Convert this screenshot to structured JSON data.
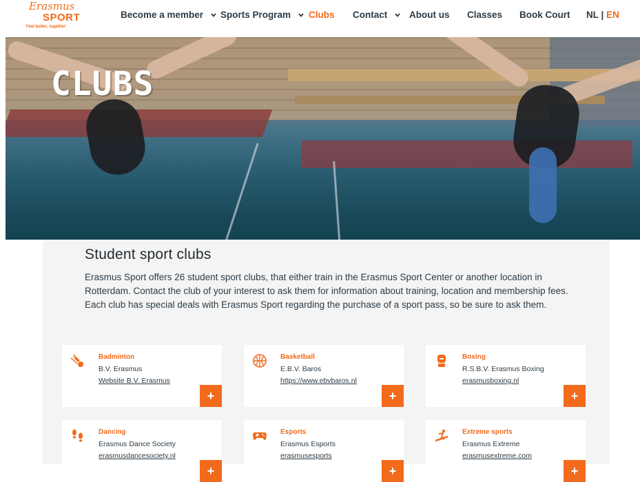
{
  "nav": {
    "logo": {
      "script": "Erasmus",
      "sport": "SPORT",
      "tagline": "Feel better, together"
    },
    "items": [
      {
        "label": "Become a member",
        "dropdown": true
      },
      {
        "label": "Sports Program",
        "dropdown": true
      },
      {
        "label": "Clubs",
        "dropdown": false,
        "active": true
      },
      {
        "label": "Contact",
        "dropdown": true
      },
      {
        "label": "About us",
        "dropdown": false
      },
      {
        "label": "Classes",
        "dropdown": false
      },
      {
        "label": "Book Court",
        "dropdown": false
      }
    ],
    "lang_nl": "NL",
    "lang_sep": "|",
    "lang_en": "EN"
  },
  "hero": {
    "title": "CLUBS"
  },
  "main": {
    "title": "Student sport clubs",
    "intro": "Erasmus Sport offers 26 student sport clubs, that either train in the Erasmus Sport Center or another location in Rotterdam. Contact the club of your interest to ask them for information about training, location and membership fees. Each club has special deals with Erasmus Sport regarding the purchase of a sport pass, so be sure to ask them."
  },
  "clubs": [
    {
      "category": "Badminton",
      "name": "B.V. Erasmus",
      "link": "Website B.V. Erasmus",
      "icon": "shuttlecock-icon",
      "button": "+"
    },
    {
      "category": "Basketball",
      "name": "E.B.V. Baros",
      "link": "https://www.ebvbaros.nl",
      "icon": "basketball-icon",
      "button": "+"
    },
    {
      "category": "Boxing",
      "name": "R.S.B.V. Erasmus Boxing",
      "link": "erasmusboxing.nl",
      "icon": "boxing-glove-icon",
      "button": "+"
    },
    {
      "category": "Dancing",
      "name": "Erasmus Dance Society",
      "link": "erasmusdancesociety.nl",
      "icon": "footprints-icon",
      "button": "+"
    },
    {
      "category": "Esports",
      "name": "Erasmus Esports",
      "link": "erasmusesports",
      "icon": "gamepad-icon",
      "button": "+"
    },
    {
      "category": "Extreme sports",
      "name": "Erasmus Extreme",
      "link": "erasmusextreme.com",
      "icon": "snowboarder-icon",
      "button": "+"
    }
  ],
  "colors": {
    "accent": "#f26a1b",
    "text": "#2d3b45",
    "panel": "#f4f4f4"
  }
}
